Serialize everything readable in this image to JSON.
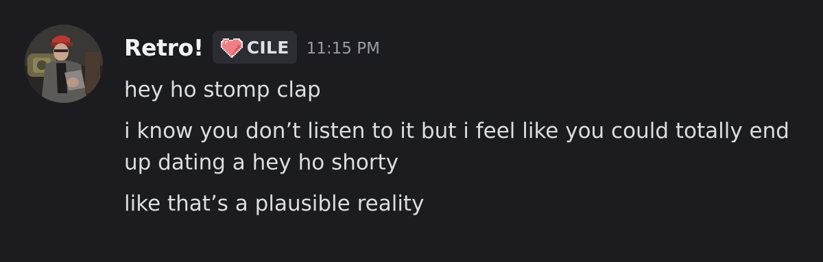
{
  "message": {
    "author": "Retro!",
    "tag": {
      "label": "CILE",
      "icon": "pixel-heart-icon",
      "icon_color": "#f08a8f"
    },
    "timestamp": "11:15 PM",
    "avatar": "user-avatar-photo",
    "lines": [
      "hey ho stomp clap",
      "i know you don’t listen to it but i feel like you could totally end up dating a hey ho shorty",
      "like that’s a plausible reality"
    ]
  },
  "colors": {
    "background": "#1c1c20",
    "username": "#f2f3f5",
    "text": "#dbdee1",
    "timestamp": "#9a9ca3",
    "tag_background": "#2b2d33"
  }
}
